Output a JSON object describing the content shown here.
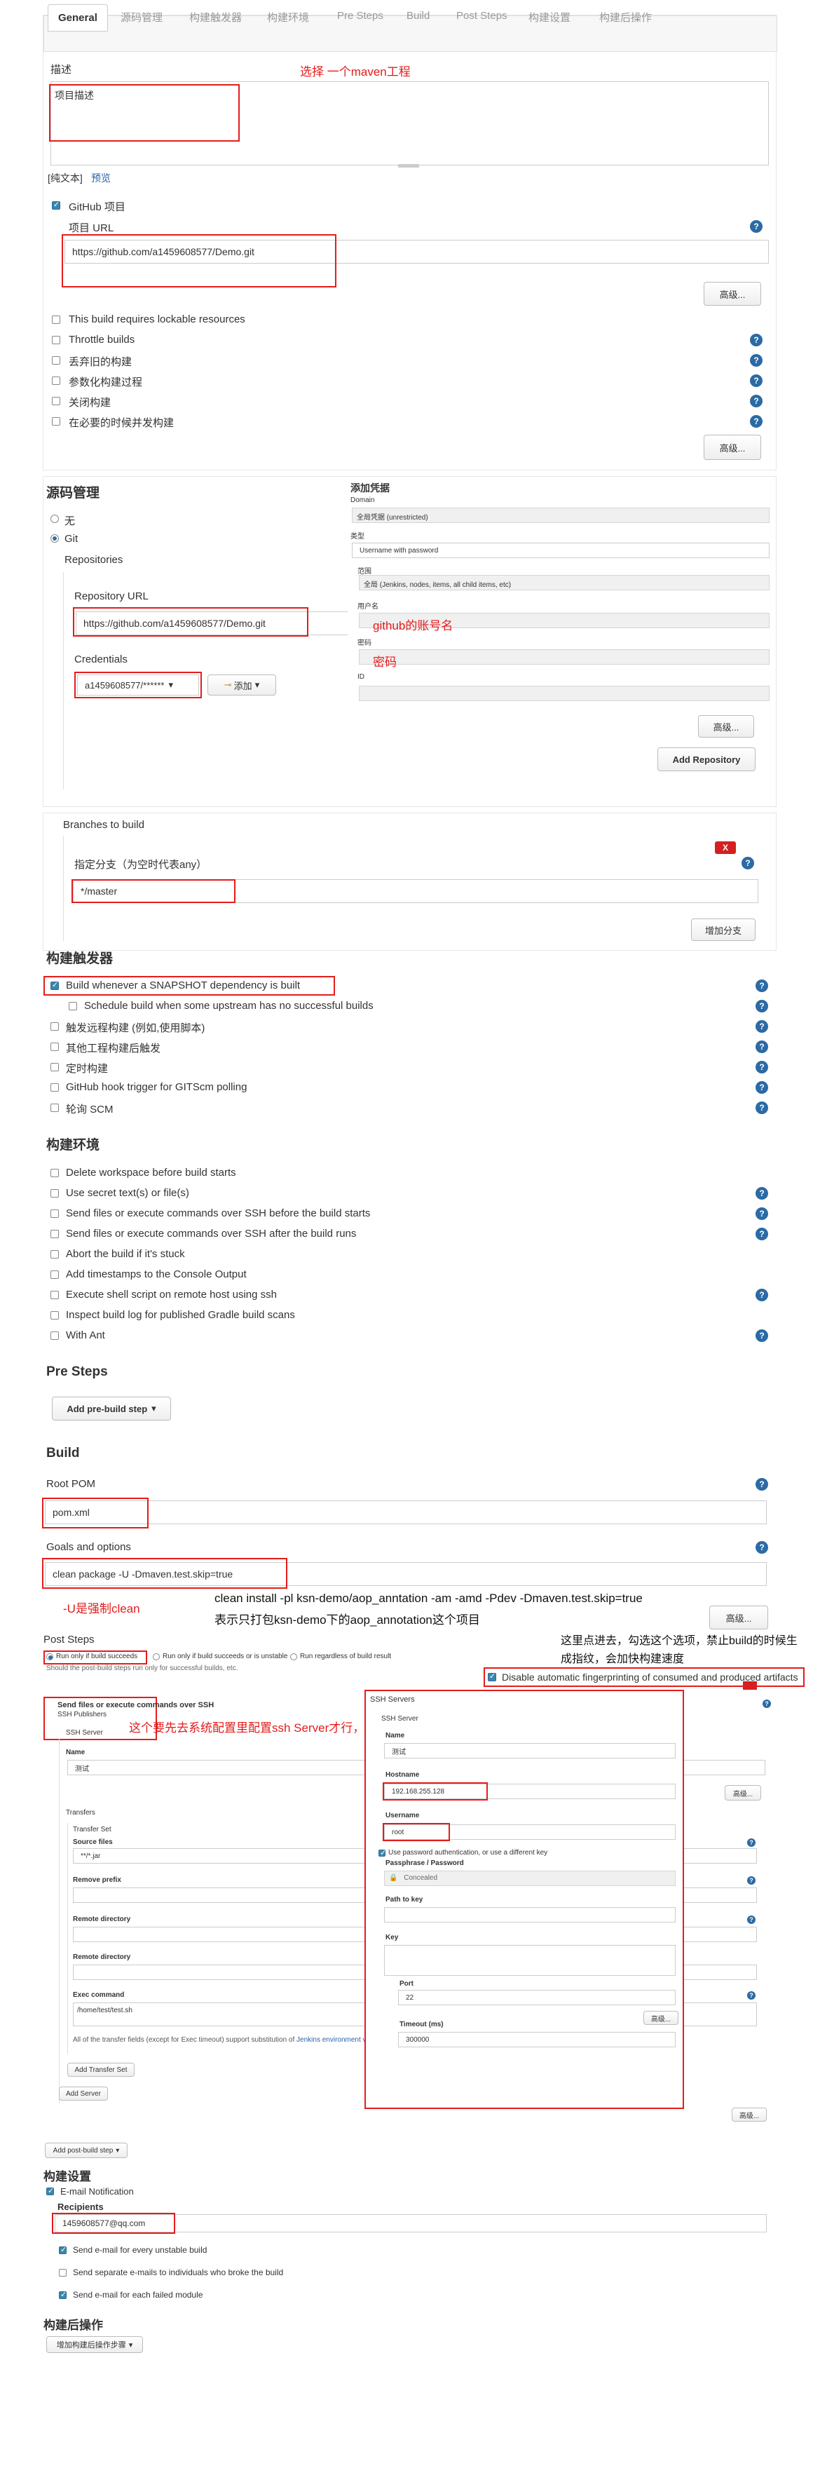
{
  "tabs": [
    "General",
    "源码管理",
    "构建触发器",
    "构建环境",
    "Pre Steps",
    "Build",
    "Post Steps",
    "构建设置",
    "构建后操作"
  ],
  "general": {
    "desc_label": "描述",
    "desc_value": "项目描述",
    "note_maven": "选择 一个maven工程",
    "plain_text": "[纯文本]",
    "preview": "预览",
    "github_project": "GitHub 项目",
    "project_url_label": "项目 URL",
    "project_url": "https://github.com/a1459608577/Demo.git",
    "advanced": "高级...",
    "options": [
      "This build requires lockable resources",
      "Throttle builds",
      "丢弃旧的构建",
      "参数化构建过程",
      "关闭构建",
      "在必要的时候并发构建"
    ]
  },
  "scm": {
    "title": "源码管理",
    "none": "无",
    "git": "Git",
    "repos": "Repositories",
    "repo_url_label": "Repository URL",
    "repo_url": "https://github.com/a1459608577/Demo.git",
    "cred_label": "Credentials",
    "cred_value": "a1459608577/******",
    "add_button": "添加",
    "add_repo": "Add Repository",
    "advanced": "高级...",
    "dialog": {
      "title": "添加凭据",
      "domain_label": "Domain",
      "domain_value": "全局凭据 (unrestricted)",
      "kind_label": "类型",
      "kind_value": "Username with password",
      "scope_label": "范围",
      "scope_value": "全局 (Jenkins, nodes, items, all child items, etc)",
      "user_label": "用户名",
      "pass_label": "密码",
      "id_label": "ID"
    },
    "note_account": "github的账号名",
    "note_password": "密码",
    "branches_label": "Branches to build",
    "branch_spec_label": "指定分支（为空时代表any）",
    "branch_value": "*/master",
    "add_branch": "增加分支",
    "delete_x": "X"
  },
  "triggers": {
    "title": "构建触发器",
    "items": [
      "Build whenever a SNAPSHOT dependency is built",
      "Schedule build when some upstream has no successful builds",
      "触发远程构建 (例如,使用脚本)",
      "其他工程构建后触发",
      "定时构建",
      "GitHub hook trigger for GITScm polling",
      "轮询 SCM"
    ]
  },
  "env": {
    "title": "构建环境",
    "items": [
      "Delete workspace before build starts",
      "Use secret text(s) or file(s)",
      "Send files or execute commands over SSH before the build starts",
      "Send files or execute commands over SSH after the build runs",
      "Abort the build if it's stuck",
      "Add timestamps to the Console Output",
      "Execute shell script on remote host using ssh",
      "Inspect build log for published Gradle build scans",
      "With Ant"
    ]
  },
  "presteps": {
    "title": "Pre Steps",
    "add": "Add pre-build step"
  },
  "build": {
    "title": "Build",
    "root_pom_label": "Root POM",
    "root_pom": "pom.xml",
    "goals_label": "Goals and options",
    "goals": "clean package -U -Dmaven.test.skip=true",
    "note_u": "-U是强制clean",
    "note_cmd": "clean install -pl ksn-demo/aop_anntation -am -amd -Pdev -Dmaven.test.skip=true",
    "note_cmd2": "表示只打包ksn-demo下的aop_annotation这个项目",
    "advanced": "高级..."
  },
  "poststeps": {
    "title": "Post Steps",
    "r1": "Run only if build succeeds",
    "r2": "Run only if build succeeds or is unstable",
    "r3": "Run regardless of build result",
    "hint": "Should the post-build steps run only for successful builds, etc.",
    "note_fp": "这里点进去，勾选这个选项，禁止build的时候生成指纹，会加快构建速度",
    "fp_option": "Disable automatic fingerprinting of consumed and produced artifacts",
    "ssh_title": "Send files or execute commands over SSH",
    "ssh_publishers": "SSH Publishers",
    "ssh_server": "SSH Server",
    "note_ssh": "这个要先去系统配置里配置ssh Server才行，要先下载ssh插件",
    "name_label": "Name",
    "name_value": "测试",
    "transfers": "Transfers",
    "transfer_set": "Transfer Set",
    "source_files": "Source files",
    "source_value": "**/*.jar",
    "remove_prefix": "Remove prefix",
    "remote_dir": "Remote directory",
    "remote_dir2": "Remote directory",
    "exec_cmd": "Exec command",
    "exec_value": "/home/test/test.sh",
    "transfer_note": "All of the transfer fields (except for Exec timeout) support substitution of",
    "transfer_link": "Jenkins environment vari",
    "add_transfer": "Add Transfer Set",
    "add_server": "Add Server",
    "advanced": "高级...",
    "add_post": "Add post-build step",
    "dlg": {
      "title": "SSH Servers",
      "server": "SSH Server",
      "name_label": "Name",
      "name_value": "测试",
      "host_label": "Hostname",
      "host_value": "192.168.255.128",
      "user_label": "Username",
      "user_value": "root",
      "use_pw": "Use password authentication, or use a different key",
      "pass_label": "Passphrase / Password",
      "pass_value": "Concealed",
      "path_label": "Path to key",
      "key_label": "Key",
      "port_label": "Port",
      "port_value": "22",
      "timeout_label": "Timeout (ms)",
      "timeout_value": "300000",
      "advanced": "高级..."
    }
  },
  "settings": {
    "title": "构建设置",
    "email": "E-mail Notification",
    "recipients_label": "Recipients",
    "recipients": "1459608577@qq.com",
    "opt1": "Send e-mail for every unstable build",
    "opt2": "Send separate e-mails to individuals who broke the build",
    "opt3": "Send e-mail for each failed module"
  },
  "post": {
    "title": "构建后操作",
    "add": "增加构建后操作步骤"
  }
}
